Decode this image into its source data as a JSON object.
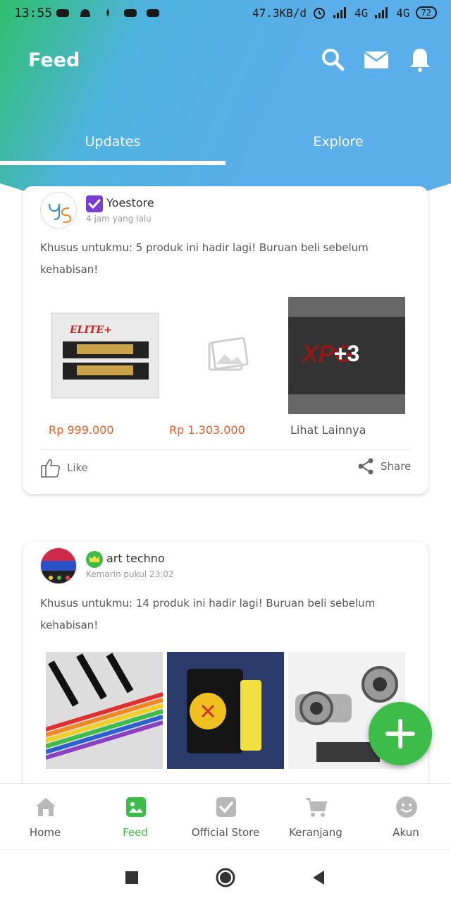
{
  "status_bar": {
    "time": "13:55",
    "speed": "47.3KB/d",
    "signal1": "4G",
    "signal2": "4G",
    "battery": "72"
  },
  "header": {
    "title": "Feed",
    "icons": [
      "search-icon",
      "mail-icon",
      "bell-icon"
    ],
    "tabs": [
      {
        "label": "Updates",
        "active": true
      },
      {
        "label": "Explore",
        "active": false
      }
    ]
  },
  "posts": [
    {
      "store_name": "Yoestore",
      "badge": "verified-badge-icon",
      "time": "4 jam yang lalu",
      "text": "Khusus untukmu: 5 produk ini hadir lagi! Buruan beli sebelum kehabisan!",
      "prices": [
        "Rp 999.000",
        "Rp 1.303.000"
      ],
      "see_more": "Lihat Lainnya",
      "extra_count": "+3",
      "like_label": "Like",
      "share_label": "Share"
    },
    {
      "store_name": "art techno",
      "badge": "crown-badge-icon",
      "time": "Kemarin pukul 23:02",
      "text": "Khusus untukmu: 14 produk ini hadir lagi! Buruan beli sebelum kehabisan!"
    }
  ],
  "bottom_nav": [
    {
      "label": "Home",
      "icon": "home-icon",
      "active": false
    },
    {
      "label": "Feed",
      "icon": "feed-icon",
      "active": true
    },
    {
      "label": "Official Store",
      "icon": "official-store-icon",
      "active": false
    },
    {
      "label": "Keranjang",
      "icon": "cart-icon",
      "active": false
    },
    {
      "label": "Akun",
      "icon": "account-icon",
      "active": false
    }
  ],
  "colors": {
    "accent_green": "#3ebc4a",
    "price_orange": "#ee5a24",
    "header_blue": "#5aaee9"
  }
}
